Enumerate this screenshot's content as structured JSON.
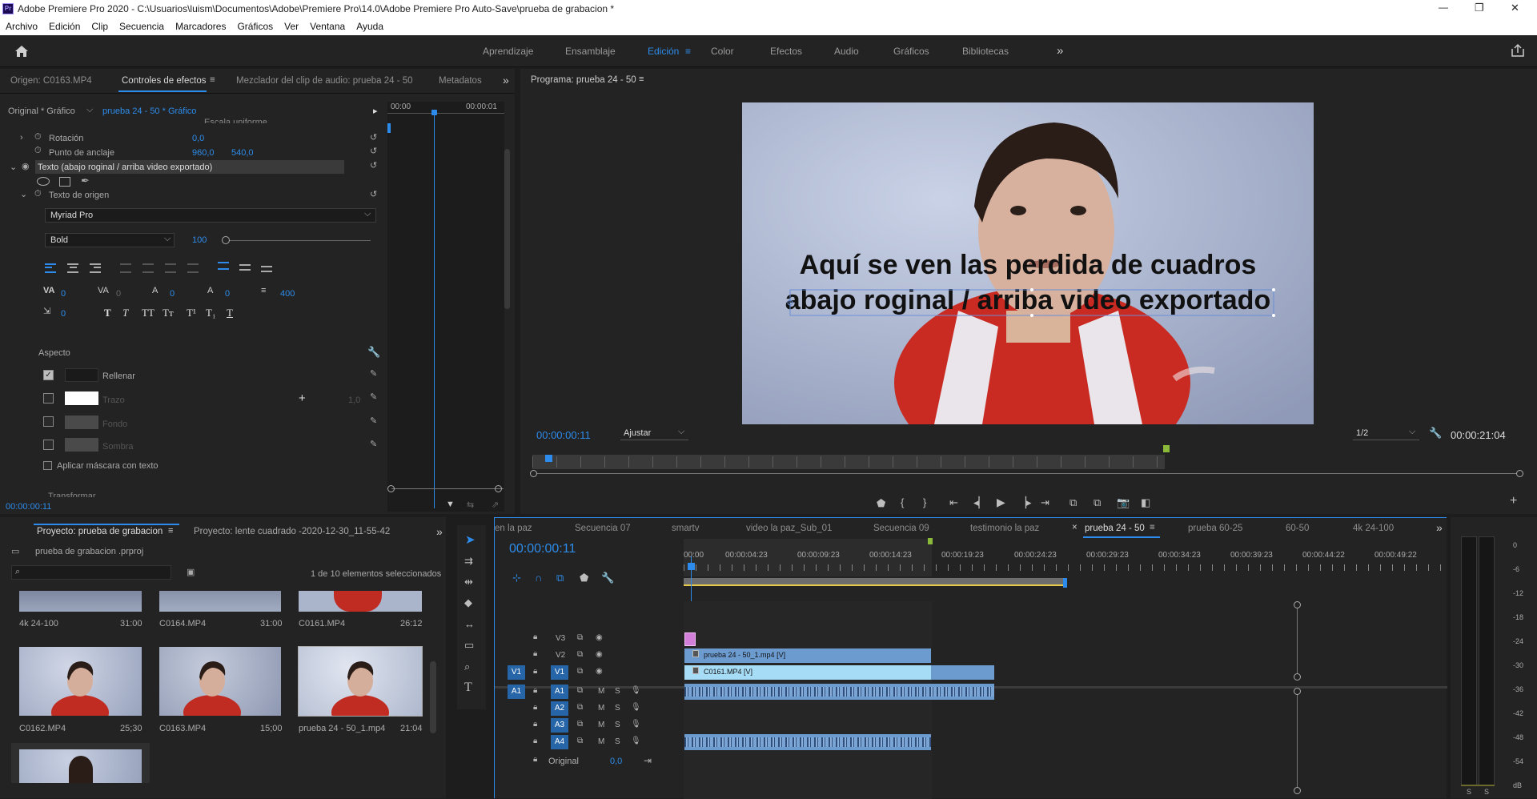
{
  "app": {
    "title": "Adobe Premiere Pro 2020 - C:\\Usuarios\\luism\\Documentos\\Adobe\\Premiere Pro\\14.0\\Adobe Premiere Pro Auto-Save\\prueba de grabacion  *",
    "logo": "Pr"
  },
  "window_controls": [
    "—",
    "❐",
    "✕"
  ],
  "menu": [
    "Archivo",
    "Edición",
    "Clip",
    "Secuencia",
    "Marcadores",
    "Gráficos",
    "Ver",
    "Ventana",
    "Ayuda"
  ],
  "workspaces": [
    "Aprendizaje",
    "Ensamblaje",
    "Edición",
    "Color",
    "Efectos",
    "Audio",
    "Gráficos",
    "Bibliotecas"
  ],
  "workspaces_more": "»",
  "source_panel": {
    "tabs": [
      "Origen: C0163.MP4",
      "Controles de efectos",
      "Mezclador del clip de audio: prueba 24 - 50",
      "Metadatos"
    ],
    "crumb_master": "Original * Gráfico",
    "crumb_seq": "prueba 24 - 50 * Gráfico",
    "mini_tc_start": "00:00",
    "mini_tc_end": "00:00:01",
    "scale_uniform": "Escala uniforme",
    "rotation_label": "Rotación",
    "rotation_value": "0,0",
    "anchor_label": "Punto de anclaje",
    "anchor_x": "960,0",
    "anchor_y": "540,0",
    "text_layer": "Texto (abajo roginal / arriba video exportado)",
    "source_text_label": "Texto de origen",
    "font": "Myriad Pro",
    "style": "Bold",
    "size": "100",
    "kerning": "0",
    "tracking": "0",
    "baseline": "0",
    "tsume": "0",
    "leading": "400",
    "indent": "0",
    "aspect_label": "Aspecto",
    "fill_label": "Rellenar",
    "stroke_label": "Trazo",
    "stroke_width": "1,0",
    "bg_label": "Fondo",
    "shadow_label": "Sombra",
    "mask_label": "Aplicar máscara con texto",
    "transform_label": "Transformar",
    "current_tc": "00:00:00:11"
  },
  "program": {
    "title": "Programa: prueba 24 - 50",
    "caption_line1": "Aquí se ven las perdida de cuadros",
    "caption_line2": "abajo roginal / arriba video exportado",
    "timecode": "00:00:00:11",
    "fit": "Ajustar",
    "resolution": "1/2",
    "duration": "00:00:21:04",
    "playhead_fraction": 0.02
  },
  "project": {
    "tabs": [
      "Proyecto: prueba de grabacion",
      "Proyecto: lente cuadrado -2020-12-30_11-55-42"
    ],
    "file": "prueba de grabacion .prproj",
    "selection": "1 de 10 elementos seleccionados",
    "search_placeholder": "",
    "items": [
      {
        "name": "4k 24-100",
        "dur": "31:00"
      },
      {
        "name": "C0164.MP4",
        "dur": "31:00"
      },
      {
        "name": "C0161.MP4",
        "dur": "26:12"
      },
      {
        "name": "C0162.MP4",
        "dur": "25;30"
      },
      {
        "name": "C0163.MP4",
        "dur": "15;00"
      },
      {
        "name": "prueba 24 - 50_1.mp4",
        "dur": "21:04"
      }
    ]
  },
  "timeline": {
    "tabs": [
      "en la paz",
      "Secuencia 07",
      "smartv",
      "video la paz_Sub_01",
      "Secuencia 09",
      "testimonio la paz",
      "prueba 24 - 50",
      "prueba 60-25",
      "60-50",
      "4k 24-100"
    ],
    "active_tab": "prueba 24 - 50",
    "timecode": "00:00:00:11",
    "ruler": [
      "00:00",
      "00:00:04:23",
      "00:00:09:23",
      "00:00:14:23",
      "00:00:19:23",
      "00:00:24:23",
      "00:00:29:23",
      "00:00:34:23",
      "00:00:39:23",
      "00:00:44:22",
      "00:00:49:22"
    ],
    "video_tracks": [
      "V3",
      "V2",
      "V1"
    ],
    "audio_tracks": [
      "A1",
      "A2",
      "A3",
      "A4"
    ],
    "src_v": "V1",
    "src_a": "A1",
    "clip_v2": "prueba 24 - 50_1.mp4 [V]",
    "clip_v1": "C0161.MP4 [V]",
    "master_label": "Original",
    "master_value": "0,0",
    "m": "M",
    "s": "S"
  },
  "meter": {
    "scale": [
      "0",
      "-6",
      "-12",
      "-18",
      "-24",
      "-30",
      "-36",
      "-42",
      "-48",
      "-54",
      "dB"
    ],
    "s": "S"
  },
  "colors": {
    "accent": "#2d8ceb",
    "clip_v1": "#a7dcf6",
    "clip_v2": "#6c9bcf",
    "clip_audio": "#6c9bcf",
    "graphic": "#d27fd9"
  }
}
